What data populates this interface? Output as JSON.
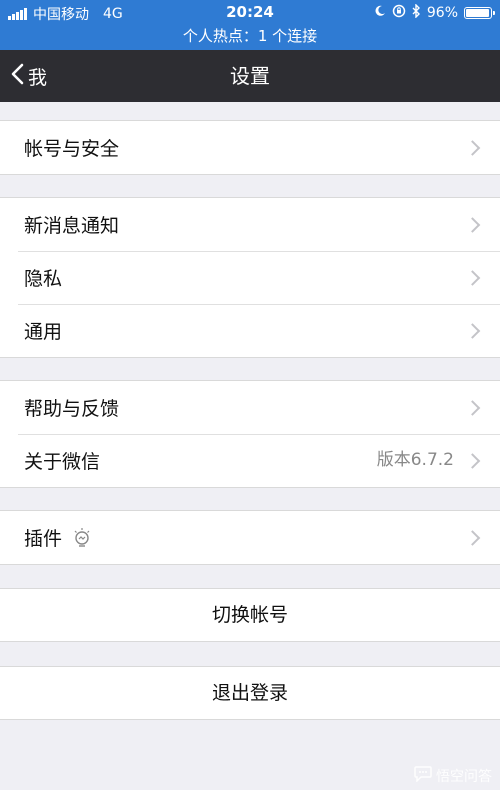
{
  "status_bar": {
    "carrier": "中国移动",
    "network": "4G",
    "time": "20:24",
    "battery": "96%",
    "battery_level": 0.96,
    "hotspot_text": "个人热点：1 个连接"
  },
  "nav": {
    "back_label": "我",
    "title": "设置"
  },
  "groups": [
    {
      "items": [
        {
          "label": "帐号与安全"
        }
      ]
    },
    {
      "items": [
        {
          "label": "新消息通知"
        },
        {
          "label": "隐私"
        },
        {
          "label": "通用"
        }
      ]
    },
    {
      "items": [
        {
          "label": "帮助与反馈"
        },
        {
          "label": "关于微信",
          "value": "版本6.7.2"
        }
      ]
    },
    {
      "items": [
        {
          "label": "插件"
        }
      ]
    }
  ],
  "actions": {
    "switch_account": "切换帐号",
    "logout": "退出登录"
  },
  "watermark": "悟空问答",
  "colors": {
    "status_bar": "#2f7bd3",
    "nav_bar": "#2d2d32",
    "background": "#efeff4"
  }
}
